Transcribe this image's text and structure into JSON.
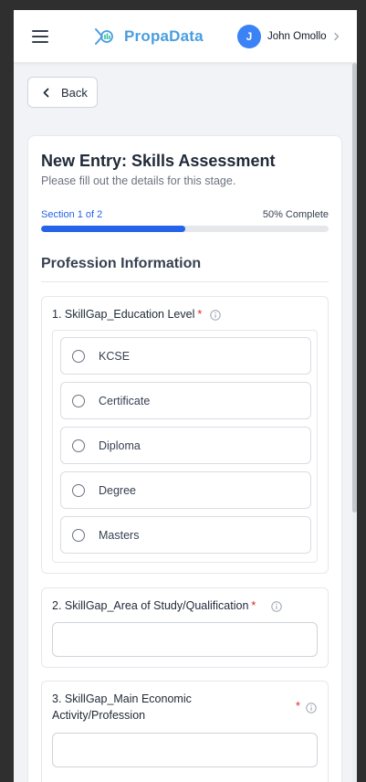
{
  "header": {
    "app_name": "PropaData",
    "user_initial": "J",
    "user_name": "John Omollo"
  },
  "colors": {
    "brand": "#4a9ee0",
    "accent": "#2563eb",
    "avatar": "#3b82f6",
    "required": "#dc2626"
  },
  "nav": {
    "back_label": "Back"
  },
  "form": {
    "title": "New Entry: Skills Assessment",
    "subtitle": "Please fill out the details for this stage.",
    "section_label": "Section 1 of 2",
    "progress_label": "50% Complete",
    "progress_value": 0.5,
    "section_heading": "Profession Information",
    "questions": [
      {
        "label": "1. SkillGap_Education Level",
        "required_mark": "*",
        "options": [
          "KCSE",
          "Certificate",
          "Diploma",
          "Degree",
          "Masters"
        ]
      },
      {
        "label": "2. SkillGap_Area of Study/Qualification",
        "required_mark": "*",
        "value": ""
      },
      {
        "label_line1": "3. SkillGap_Main Economic",
        "label_line2": "Activity/Profession",
        "required_mark": "*",
        "value": ""
      }
    ]
  }
}
